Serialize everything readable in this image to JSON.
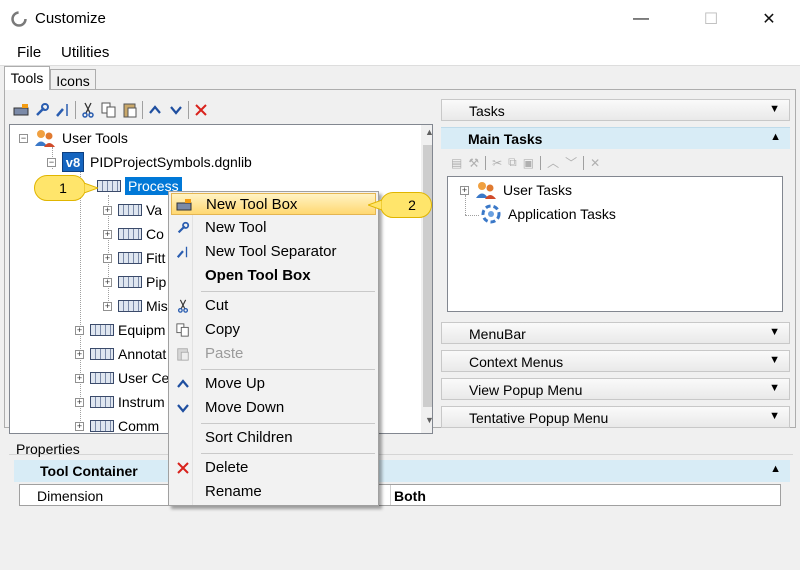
{
  "window": {
    "title": "Customize",
    "minimize_glyph": "—",
    "maximize_glyph": "☐",
    "close_glyph": "✕"
  },
  "menu": {
    "file": "File",
    "utilities": "Utilities"
  },
  "tabs": {
    "tools": "Tools",
    "icons": "Icons"
  },
  "toolbar_icons": [
    "new-tool-box-icon",
    "new-tool-icon",
    "new-tool-separator-icon",
    "cut-icon",
    "copy-icon",
    "paste-icon",
    "move-up-icon",
    "move-down-icon",
    "delete-icon"
  ],
  "tree": {
    "root": "User Tools",
    "library": "PIDProjectSymbols.dgnlib",
    "library_badge": "v8",
    "selected": "Process",
    "children": [
      "Va",
      "Co",
      "Fitt",
      "Pip",
      "Mis"
    ],
    "siblings": [
      "Equipm",
      "Annotat",
      "User Ce",
      "Instrum",
      "Comm"
    ]
  },
  "callouts": {
    "one": "1",
    "two": "2"
  },
  "context_menu": {
    "new_tool_box": "New Tool Box",
    "new_tool": "New Tool",
    "new_tool_separator": "New Tool Separator",
    "open_tool_box": "Open Tool Box",
    "cut": "Cut",
    "copy": "Copy",
    "paste": "Paste",
    "move_up": "Move Up",
    "move_down": "Move Down",
    "sort_children": "Sort Children",
    "delete": "Delete",
    "rename": "Rename"
  },
  "right_panels": {
    "tasks": "Tasks",
    "main_tasks": "Main Tasks",
    "user_tasks": "User Tasks",
    "application_tasks": "Application Tasks",
    "menubar": "MenuBar",
    "context_menus": "Context Menus",
    "view_popup_menu": "View Popup Menu",
    "tentative_popup_menu": "Tentative Popup Menu"
  },
  "properties": {
    "label": "Properties",
    "section": "Tool Container",
    "rows": [
      {
        "name": "Dimension",
        "value": "Both"
      }
    ]
  },
  "colors": {
    "selection": "#0078d7",
    "highlight": "#ffd872",
    "section_header": "#d8ecf6",
    "callout": "#ffe56b"
  }
}
